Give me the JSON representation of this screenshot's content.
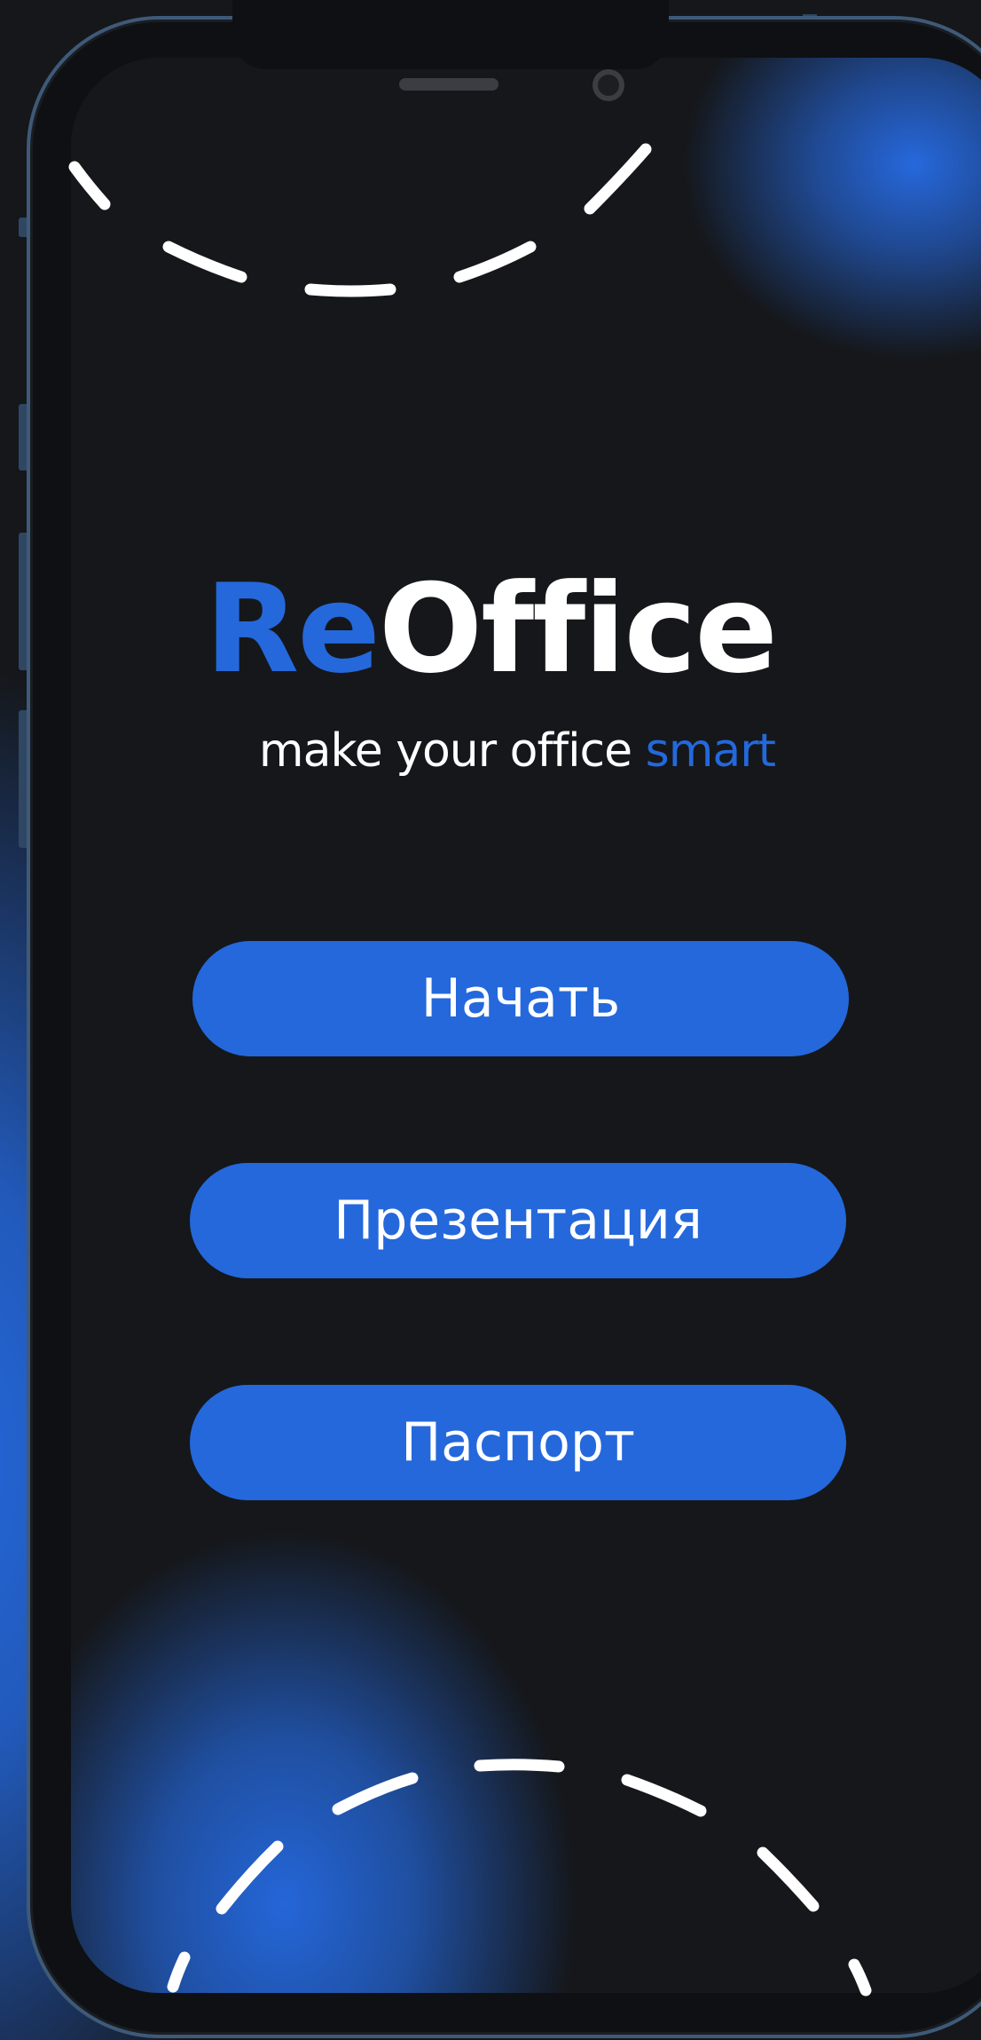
{
  "app": {
    "logo_prefix": "Re",
    "logo_suffix": "Office",
    "tagline_main": "make your office ",
    "tagline_accent": "smart"
  },
  "menu": {
    "start_label": "Начать",
    "presentation_label": "Презентация",
    "passport_label": "Паспорт"
  },
  "colors": {
    "accent": "#2468dc",
    "background": "#15171a",
    "text": "#ffffff"
  }
}
